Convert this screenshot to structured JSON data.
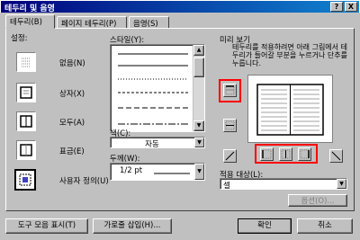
{
  "window": {
    "title": "테두리 및 음영",
    "help_button": "?",
    "close_button": "X"
  },
  "tabs": [
    {
      "label": "테두리(B)"
    },
    {
      "label": "페이지 테두리(P)"
    },
    {
      "label": "음영(S)"
    }
  ],
  "settings": {
    "heading": "설정:",
    "items": [
      {
        "label": "없음(N)"
      },
      {
        "label": "상자(X)"
      },
      {
        "label": "모두(A)"
      },
      {
        "label": "표금(E)"
      },
      {
        "label": "사용자 정의(U)"
      }
    ]
  },
  "style": {
    "heading": "스타일(Y):"
  },
  "color": {
    "heading": "색(C):",
    "value": "자동"
  },
  "width": {
    "heading": "두께(W):",
    "value": "1/2 pt"
  },
  "preview": {
    "heading": "미리 보기",
    "instructions": "테두리를 적용하려면 아래 그림에서 테두리가 들어갈 부분을 누르거나 단추를 누릅니다."
  },
  "apply_to": {
    "heading": "적용 대상(L):",
    "value": "셀"
  },
  "buttons": {
    "options": "옵션(O)...",
    "show_toolbar": "도구 모음 표시(T)",
    "horizontal_line": "가로줄 삽입(H)...",
    "ok": "확인",
    "cancel": "취소"
  },
  "colors": {
    "highlight": "#ff0000",
    "title_bar": "#00007b",
    "face": "#c0c0c0"
  }
}
